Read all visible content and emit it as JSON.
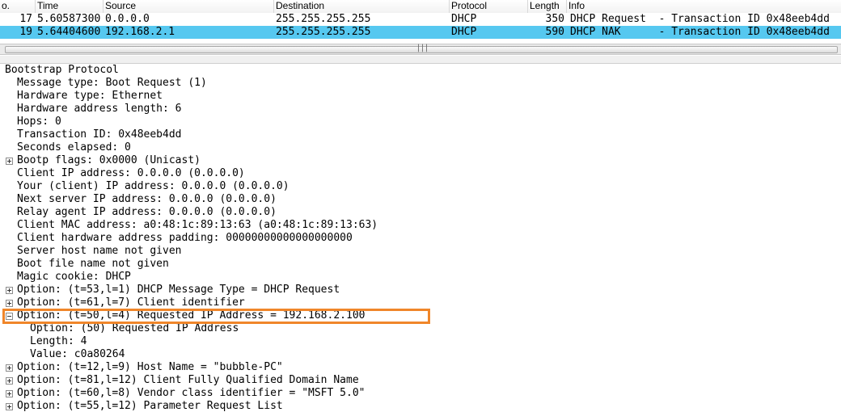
{
  "packet_list": {
    "columns": [
      "o.",
      "Time",
      "Source",
      "Destination",
      "Protocol",
      "Length",
      "Info"
    ],
    "rows": [
      {
        "no": "17",
        "time": "5.60587300",
        "source": "0.0.0.0",
        "destination": "255.255.255.255",
        "protocol": "DHCP",
        "length": "350",
        "info": "DHCP Request  - Transaction ID 0x48eeb4dd",
        "selected": false
      },
      {
        "no": "19",
        "time": "5.64404600",
        "source": "192.168.2.1",
        "destination": "255.255.255.255",
        "protocol": "DHCP",
        "length": "590",
        "info": "DHCP NAK      - Transaction ID 0x48eeb4dd",
        "selected": true
      }
    ],
    "scroll_grip": "|||"
  },
  "details": {
    "title": "Bootstrap Protocol",
    "lines": [
      {
        "text": "Message type: Boot Request (1)"
      },
      {
        "text": "Hardware type: Ethernet"
      },
      {
        "text": "Hardware address length: 6"
      },
      {
        "text": "Hops: 0"
      },
      {
        "text": "Transaction ID: 0x48eeb4dd"
      },
      {
        "text": "Seconds elapsed: 0"
      },
      {
        "text": "Bootp flags: 0x0000 (Unicast)",
        "expander": "plus"
      },
      {
        "text": "Client IP address: 0.0.0.0 (0.0.0.0)"
      },
      {
        "text": "Your (client) IP address: 0.0.0.0 (0.0.0.0)"
      },
      {
        "text": "Next server IP address: 0.0.0.0 (0.0.0.0)"
      },
      {
        "text": "Relay agent IP address: 0.0.0.0 (0.0.0.0)"
      },
      {
        "text": "Client MAC address: a0:48:1c:89:13:63 (a0:48:1c:89:13:63)"
      },
      {
        "text": "Client hardware address padding: 00000000000000000000"
      },
      {
        "text": "Server host name not given"
      },
      {
        "text": "Boot file name not given"
      },
      {
        "text": "Magic cookie: DHCP"
      },
      {
        "text": "Option: (t=53,l=1) DHCP Message Type = DHCP Request",
        "expander": "plus"
      },
      {
        "text": "Option: (t=61,l=7) Client identifier",
        "expander": "plus"
      },
      {
        "text": "Option: (t=50,l=4) Requested IP Address = 192.168.2.100",
        "expander": "minus",
        "highlighted": true
      },
      {
        "text": "Option: (50) Requested IP Address",
        "child": true
      },
      {
        "text": "Length: 4",
        "child": true
      },
      {
        "text": "Value: c0a80264",
        "child": true
      },
      {
        "text": "Option: (t=12,l=9) Host Name = \"bubble-PC\"",
        "expander": "plus"
      },
      {
        "text": "Option: (t=81,l=12) Client Fully Qualified Domain Name",
        "expander": "plus"
      },
      {
        "text": "Option: (t=60,l=8) Vendor class identifier = \"MSFT 5.0\"",
        "expander": "plus"
      },
      {
        "text": "Option: (t=55,l=12) Parameter Request List",
        "expander": "plus"
      }
    ]
  },
  "colors": {
    "selected_row": "#56c8f0",
    "highlight_box": "#f0862a"
  }
}
